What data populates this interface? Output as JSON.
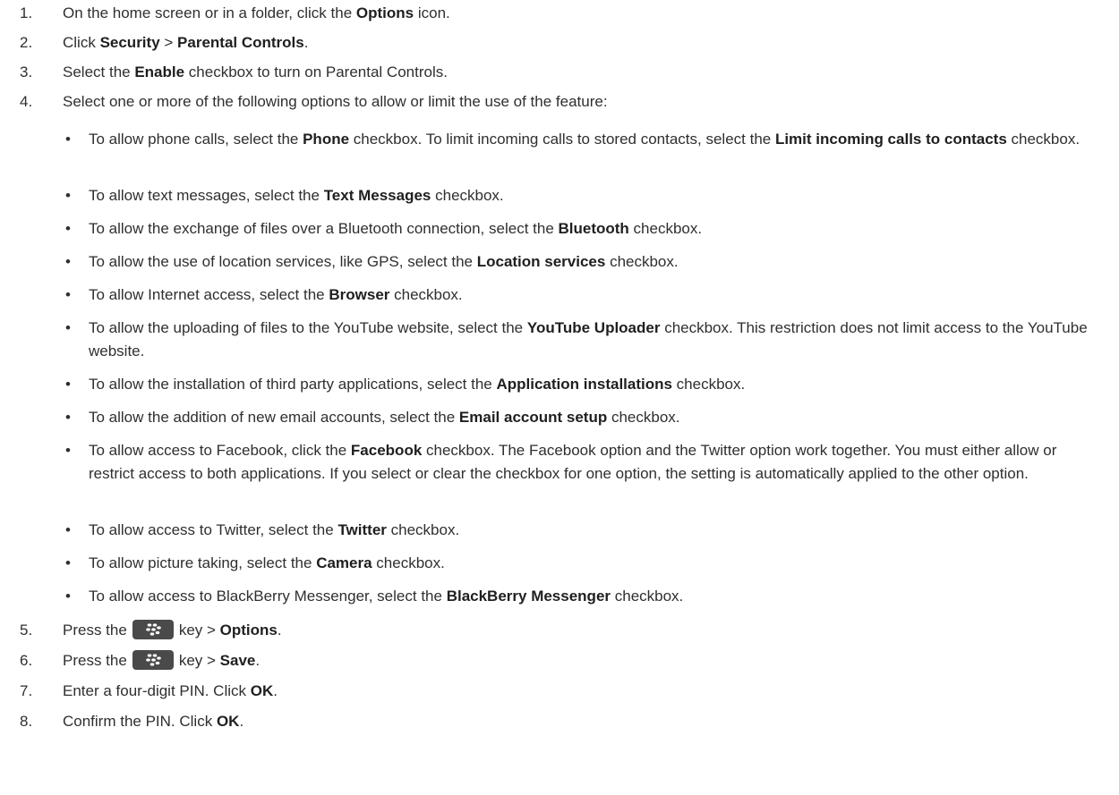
{
  "steps": [
    {
      "num": "1.",
      "pre": "On the home screen or in a folder, click the ",
      "b1": "Options",
      "post": " icon."
    },
    {
      "num": "2.",
      "pre": "Click ",
      "b1": "Security",
      "mid": " > ",
      "b2": "Parental Controls",
      "post": "."
    },
    {
      "num": "3.",
      "pre": "Select the ",
      "b1": "Enable",
      "post": " checkbox to turn on Parental Controls."
    },
    {
      "num": "4.",
      "text": "Select one or more of the following options to allow or limit the use of the feature:"
    },
    {
      "num": "5.",
      "pre": "Press the",
      "mid": "key > ",
      "b1": "Options",
      "post": "."
    },
    {
      "num": "6.",
      "pre": "Press the",
      "mid": "key > ",
      "b1": "Save",
      "post": "."
    },
    {
      "num": "7.",
      "pre": "Enter a four-digit PIN. Click ",
      "b1": "OK",
      "post": "."
    },
    {
      "num": "8.",
      "pre": "Confirm the PIN. Click ",
      "b1": "OK",
      "post": "."
    }
  ],
  "bullets": [
    {
      "pre": "To allow phone calls, select the ",
      "b1": "Phone",
      "mid": " checkbox. To limit incoming calls to stored contacts, select the ",
      "b2": "Limit incoming calls to contacts",
      "post": " checkbox."
    },
    {
      "pre": "To allow text messages, select the ",
      "b1": "Text Messages",
      "post": " checkbox."
    },
    {
      "pre": "To allow the exchange of files over a Bluetooth connection, select the ",
      "b1": "Bluetooth",
      "post": " checkbox."
    },
    {
      "pre": "To allow the use of location services, like GPS, select the ",
      "b1": "Location services",
      "post": " checkbox."
    },
    {
      "pre": "To allow Internet access, select the ",
      "b1": "Browser",
      "post": " checkbox."
    },
    {
      "pre": "To allow the uploading of files to the YouTube website, select the ",
      "b1": "YouTube Uploader",
      "post": " checkbox. This restriction does not limit access to the YouTube website."
    },
    {
      "pre": "To allow the installation of third party applications, select the ",
      "b1": "Application installations",
      "post": " checkbox."
    },
    {
      "pre": "To allow the addition of new email accounts, select the ",
      "b1": "Email account setup",
      "post": " checkbox."
    },
    {
      "pre": "To allow access to Facebook, click the ",
      "b1": "Facebook",
      "post": " checkbox. The Facebook option and the Twitter option work together. You must either allow or restrict access to both applications. If you select or clear the checkbox for one option, the setting is automatically applied to the other option."
    },
    {
      "pre": "To allow access to Twitter, select the ",
      "b1": "Twitter",
      "post": " checkbox."
    },
    {
      "pre": "To allow picture taking, select the ",
      "b1": "Camera",
      "post": " checkbox."
    },
    {
      "pre": "To allow access to BlackBerry Messenger, select the ",
      "b1": "BlackBerry Messenger",
      "post": " checkbox."
    }
  ],
  "bullet_glyph": "•",
  "menu_key_icon": "blackberry-menu-key-icon",
  "colors": {
    "text": "#2f2f2f",
    "bold": "#1f1f1f",
    "key_bg": "#4a4a4a"
  }
}
